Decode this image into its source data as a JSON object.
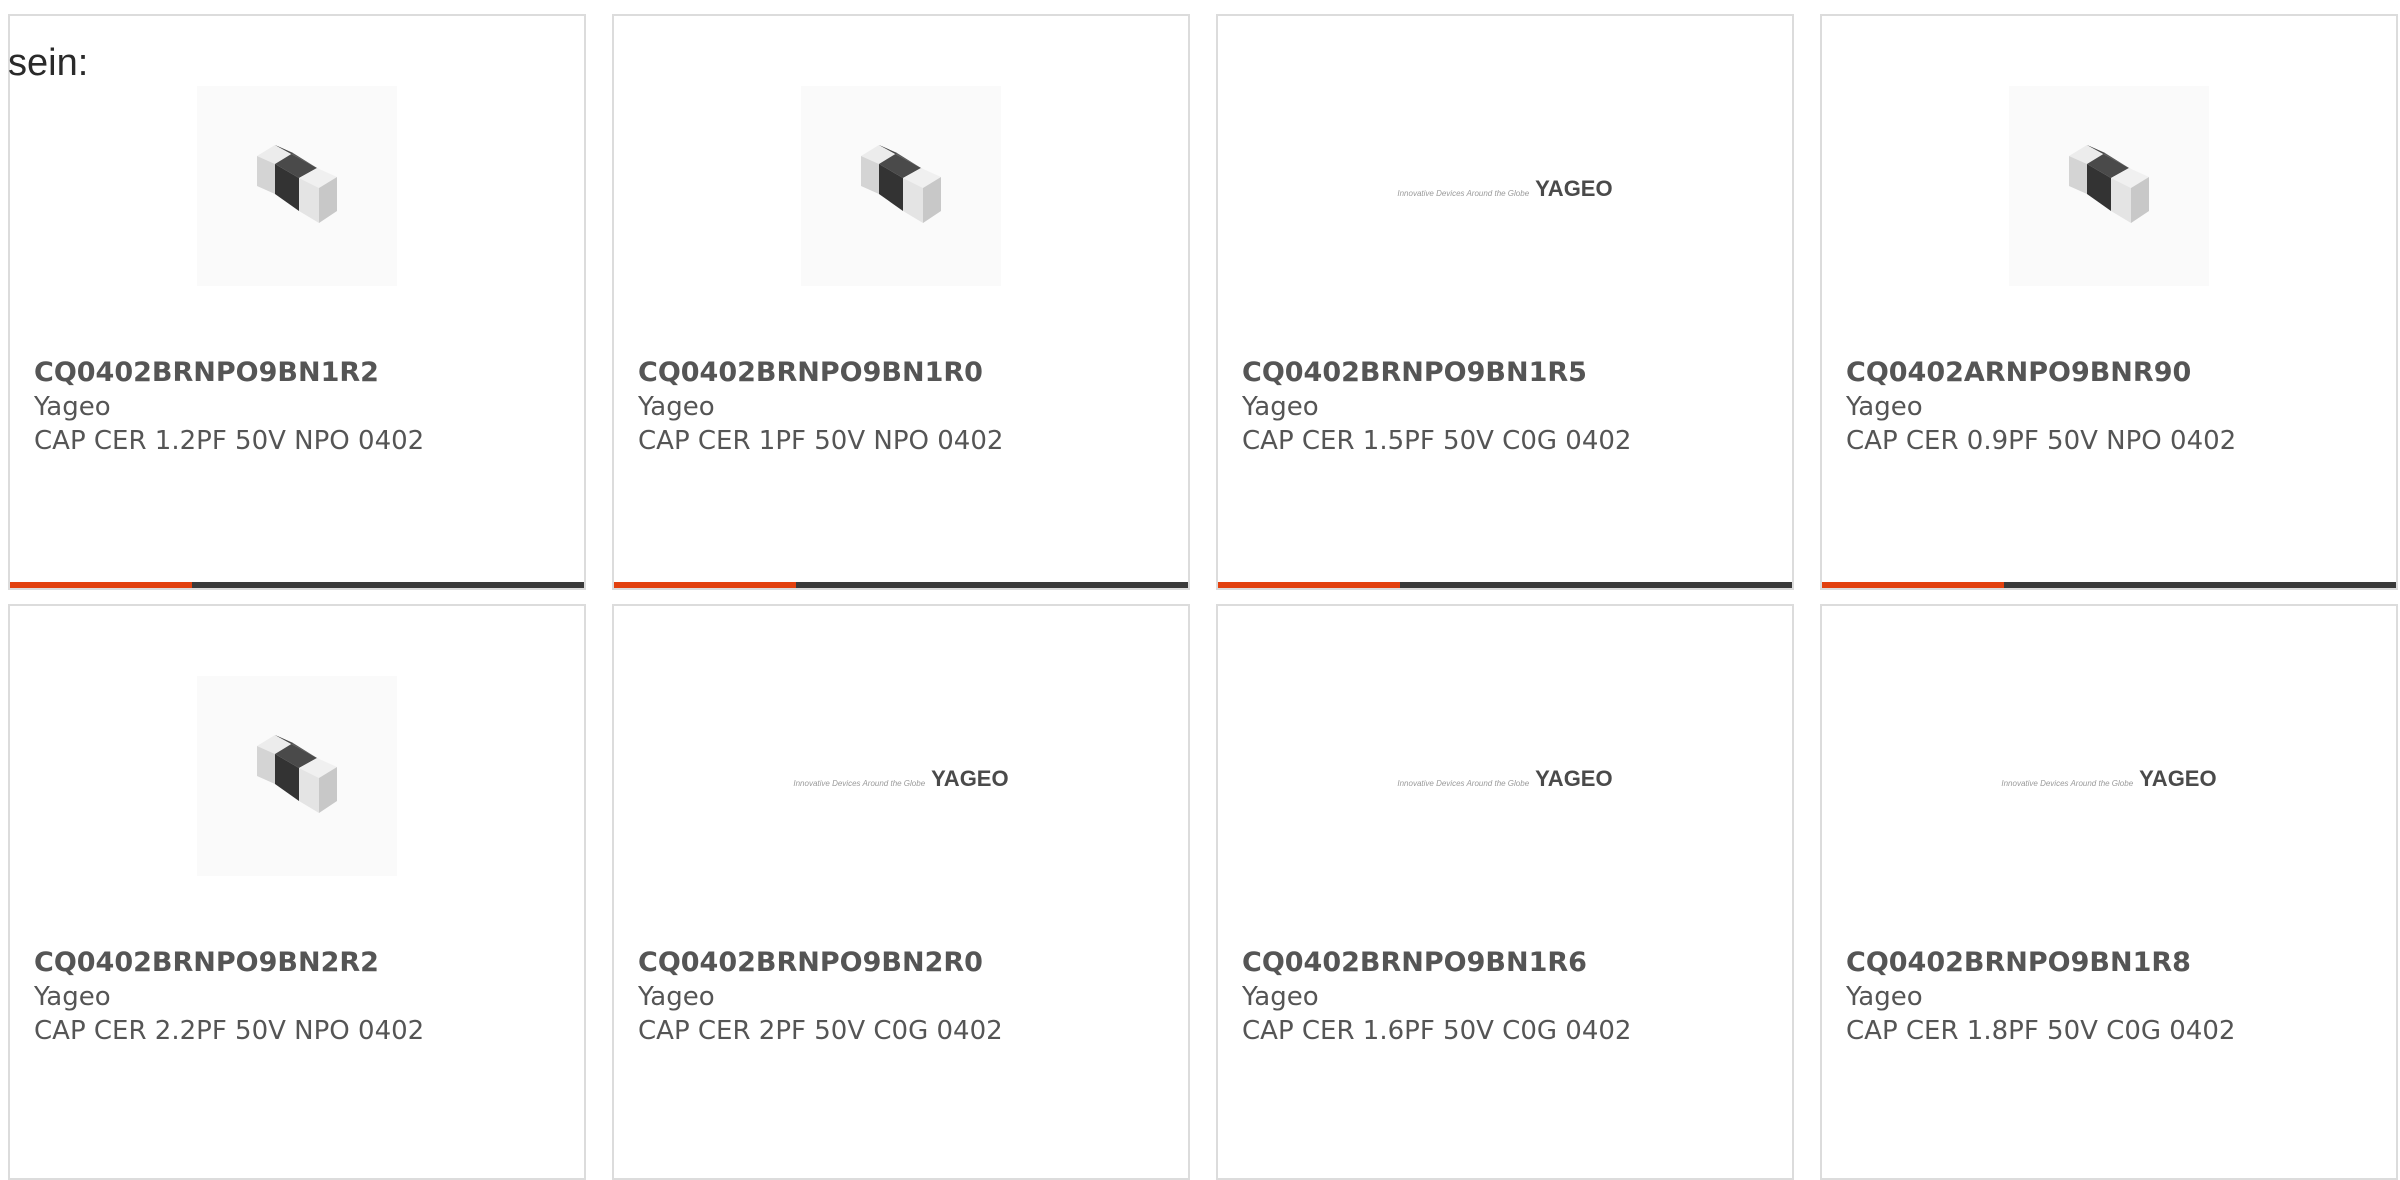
{
  "lead_text": "sein:",
  "logo": {
    "tagline": "Innovative Devices Around the Globe",
    "wordmark": "YAGEO"
  },
  "colors": {
    "accent": "#e2410f",
    "bar": "#3a3a3a",
    "border": "#dcdcdc",
    "text": "#555555"
  },
  "products": [
    {
      "part": "CQ0402BRNPO9BN1R2",
      "manufacturer": "Yageo",
      "description": "CAP CER 1.2PF 50V NPO 0402",
      "image": "chip",
      "show_bar": true
    },
    {
      "part": "CQ0402BRNPO9BN1R0",
      "manufacturer": "Yageo",
      "description": "CAP CER 1PF 50V NPO 0402",
      "image": "chip",
      "show_bar": true
    },
    {
      "part": "CQ0402BRNPO9BN1R5",
      "manufacturer": "Yageo",
      "description": "CAP CER 1.5PF 50V C0G 0402",
      "image": "logo",
      "show_bar": true
    },
    {
      "part": "CQ0402ARNPO9BNR90",
      "manufacturer": "Yageo",
      "description": "CAP CER 0.9PF 50V NPO 0402",
      "image": "chip",
      "show_bar": true
    },
    {
      "part": "CQ0402BRNPO9BN2R2",
      "manufacturer": "Yageo",
      "description": "CAP CER 2.2PF 50V NPO 0402",
      "image": "chip",
      "show_bar": false
    },
    {
      "part": "CQ0402BRNPO9BN2R0",
      "manufacturer": "Yageo",
      "description": "CAP CER 2PF 50V C0G 0402",
      "image": "logo",
      "show_bar": false
    },
    {
      "part": "CQ0402BRNPO9BN1R6",
      "manufacturer": "Yageo",
      "description": "CAP CER 1.6PF 50V C0G 0402",
      "image": "logo",
      "show_bar": false
    },
    {
      "part": "CQ0402BRNPO9BN1R8",
      "manufacturer": "Yageo",
      "description": "CAP CER 1.8PF 50V C0G 0402",
      "image": "logo",
      "show_bar": false
    }
  ]
}
